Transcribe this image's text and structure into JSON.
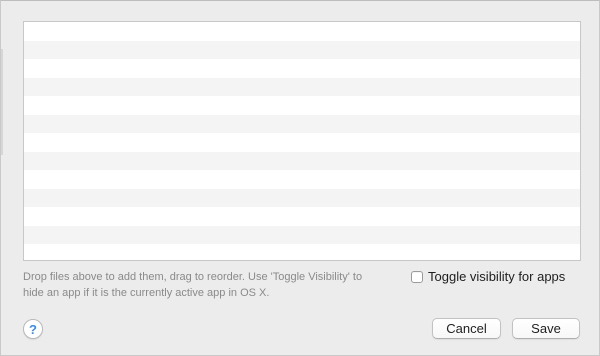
{
  "app_list": {
    "row_count": 13
  },
  "hint": {
    "line1": "Drop files above to add them, drag to reorder. Use 'Toggle Visibility' to",
    "line2": "hide an app if it is the currently active app in OS X."
  },
  "toggle": {
    "label": "Toggle visibility for apps",
    "checked": false
  },
  "help": {
    "glyph": "?",
    "icon": "help-question-icon"
  },
  "buttons": {
    "cancel": "Cancel",
    "save": "Save"
  },
  "colors": {
    "window_bg": "#ececec",
    "row_alt": "#f4f4f4",
    "help_accent": "#3b8ced",
    "hint_text": "#8a8a8a"
  }
}
